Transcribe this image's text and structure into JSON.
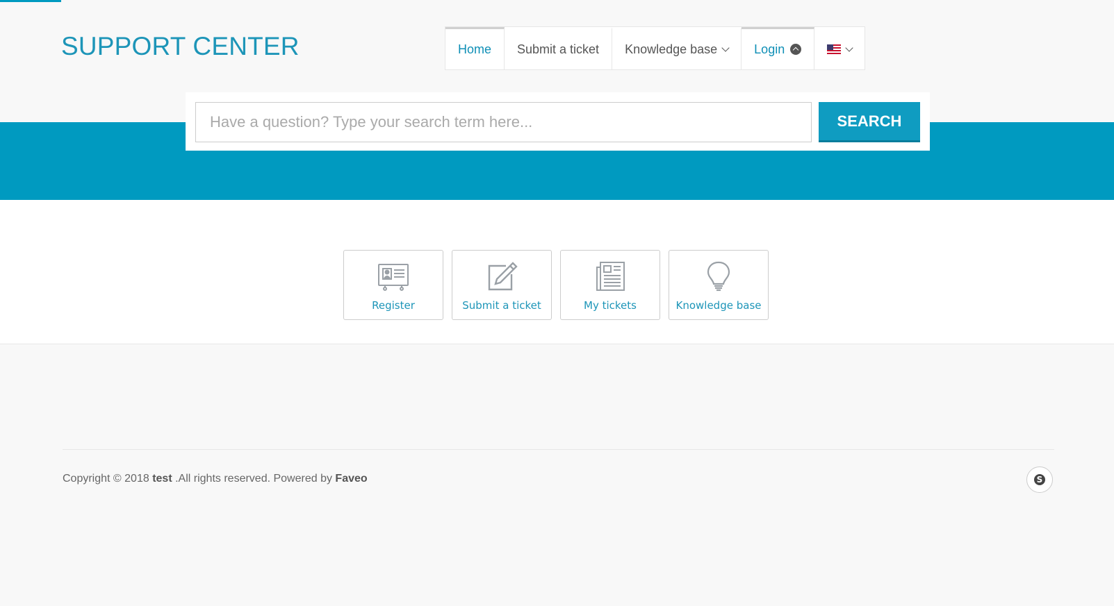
{
  "header": {
    "brand": "SUPPORT CENTER"
  },
  "nav": {
    "items": [
      {
        "label": "Home",
        "active": true
      },
      {
        "label": "Submit a ticket"
      },
      {
        "label": "Knowledge base",
        "dropdown": true
      },
      {
        "label": "Login",
        "icon": "chevron-up-circle-icon"
      },
      {
        "icon": "us-flag-icon",
        "dropdown": true
      }
    ]
  },
  "search": {
    "placeholder": "Have a question? Type your search term here...",
    "button_label": "SEARCH"
  },
  "tiles": [
    {
      "label": "Register",
      "icon": "id-card-icon"
    },
    {
      "label": "Submit a ticket",
      "icon": "edit-icon"
    },
    {
      "label": "My tickets",
      "icon": "newspaper-icon"
    },
    {
      "label": "Knowledge base",
      "icon": "lightbulb-icon"
    }
  ],
  "footer": {
    "prefix": "Copyright © 2018 ",
    "company": "test",
    "middle": " .All rights reserved. Powered by ",
    "powered": "Faveo",
    "social_icon": "skype-icon"
  },
  "colors": {
    "accent": "#009ac0",
    "link": "#1d95b8"
  }
}
